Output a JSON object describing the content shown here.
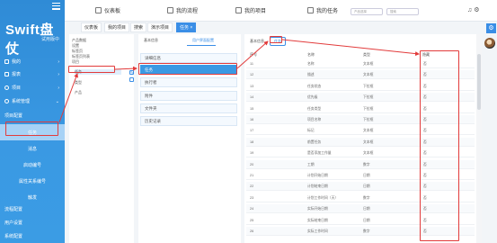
{
  "brand": {
    "logo_text": "Swift盘仗",
    "logo_sub": "试用版中"
  },
  "sidebar": {
    "items": [
      {
        "label": "我的"
      },
      {
        "label": "报表"
      },
      {
        "label": "项目"
      },
      {
        "label": "系统管理"
      },
      {
        "label": "项目配置"
      }
    ],
    "sub_items": [
      {
        "label": "任务"
      },
      {
        "label": "消息"
      },
      {
        "label": "启动编号"
      },
      {
        "label": "属性关系编号"
      },
      {
        "label": "触发"
      },
      {
        "label": "流程配置"
      },
      {
        "label": "用户设置"
      },
      {
        "label": "系统配置"
      }
    ]
  },
  "topbar": {
    "nav": [
      {
        "label": "仪表板"
      },
      {
        "label": "我的流程"
      },
      {
        "label": "我的项目"
      },
      {
        "label": "我的任务"
      }
    ],
    "select_placeholder": "产品选择",
    "search_placeholder": "搜索",
    "right_icons": "♫  ⚙"
  },
  "tabs": [
    {
      "label": "仪表板"
    },
    {
      "label": "我的项目"
    },
    {
      "label": "搜索"
    },
    {
      "label": "演示项目"
    },
    {
      "label": "任务 ×"
    }
  ],
  "tree": {
    "items": [
      "产品数据",
      "设置",
      "标签页",
      "标签页列表",
      "项目",
      "任务",
      "类型",
      "产品"
    ],
    "selected_index": 5
  },
  "middle": {
    "tabs": {
      "basic": "基本信息",
      "active": "用户界面配置"
    },
    "items": [
      {
        "label": "详细信息"
      },
      {
        "label": "任务"
      },
      {
        "label": "执行者"
      },
      {
        "label": "附件"
      },
      {
        "label": "文件夹"
      },
      {
        "label": "历史记录"
      }
    ],
    "selected_index": 1
  },
  "right": {
    "tabs": {
      "basic": "基本信息",
      "active": "任务"
    },
    "headers": {
      "col1": "序号",
      "col2": "名称",
      "col3": "类型",
      "col4": "隐藏"
    },
    "rows": [
      {
        "n": "11",
        "name": "名称",
        "type": "文本框",
        "hide": "否"
      },
      {
        "n": "12",
        "name": "描述",
        "type": "文本框",
        "hide": "否"
      },
      {
        "n": "13",
        "name": "任务状态",
        "type": "下拉框",
        "hide": "否"
      },
      {
        "n": "14",
        "name": "优先级",
        "type": "下拉框",
        "hide": "否"
      },
      {
        "n": "15",
        "name": "任务类型",
        "type": "下拉框",
        "hide": "否"
      },
      {
        "n": "16",
        "name": "项目名称",
        "type": "下拉框",
        "hide": "否"
      },
      {
        "n": "17",
        "name": "标记",
        "type": "文本框",
        "hide": "否"
      },
      {
        "n": "18",
        "name": "前置任务",
        "type": "文本框",
        "hide": "否"
      },
      {
        "n": "19",
        "name": "是否添加工作量",
        "type": "文本框",
        "hide": "否"
      },
      {
        "n": "20",
        "name": "工期",
        "type": "数字",
        "hide": "否"
      },
      {
        "n": "21",
        "name": "计划开始日期",
        "type": "日期",
        "hide": "否"
      },
      {
        "n": "22",
        "name": "计划结束日期",
        "type": "日期",
        "hide": "否"
      },
      {
        "n": "23",
        "name": "计划工作时间（天）",
        "type": "数字",
        "hide": "否"
      },
      {
        "n": "24",
        "name": "实际开始日期",
        "type": "日期",
        "hide": "否"
      },
      {
        "n": "25",
        "name": "实际结束日期",
        "type": "日期",
        "hide": "否"
      },
      {
        "n": "26",
        "name": "实际工作时间",
        "type": "数字",
        "hide": "否"
      }
    ]
  },
  "colors": {
    "sidebar": "#3a99e3",
    "accent": "#3a8ee6",
    "annotation": "#e23b3b"
  }
}
